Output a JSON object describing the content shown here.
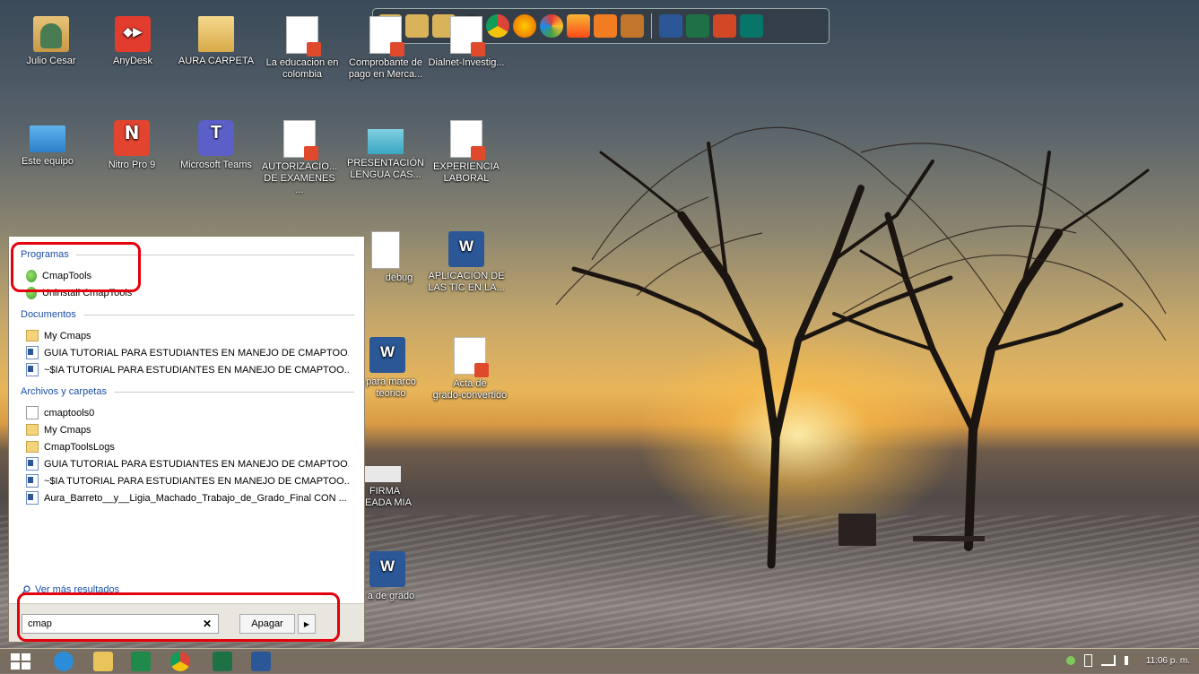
{
  "desktop": {
    "icons": [
      {
        "label": "Julio Cesar",
        "icon": "user-folder-icon"
      },
      {
        "label": "AnyDesk",
        "icon": "anydesk-icon"
      },
      {
        "label": "AURA CARPETA",
        "icon": "folder-icon"
      },
      {
        "label": "La educacion en\ncolombia",
        "icon": "pdf-document-icon"
      },
      {
        "label": "Comprobante de\npago en Merca...",
        "icon": "pdf-document-icon"
      },
      {
        "label": "Dialnet-Investig...",
        "icon": "pdf-document-icon"
      },
      {
        "label": "Este equipo",
        "icon": "computer-icon"
      },
      {
        "label": "Nitro Pro 9",
        "icon": "nitro-pro-icon"
      },
      {
        "label": "Microsoft Teams",
        "icon": "teams-icon"
      },
      {
        "label": "AUTORIZACIO...\nDE EXAMENES ...",
        "icon": "pdf-document-icon"
      },
      {
        "label": "PRESENTACIÓN\nLENGUA CAS...",
        "icon": "powerpoint-file-icon"
      },
      {
        "label": "EXPERIENCIA\nLABORAL",
        "icon": "pdf-document-icon"
      },
      {
        "label": "debug",
        "icon": "text-file-icon"
      },
      {
        "label": "APLICACIÓN DE\nLAS TIC EN LA...",
        "icon": "word-file-icon"
      },
      {
        "label": "para marco\nteorico",
        "icon": "word-file-icon"
      },
      {
        "label": "Acta de\ngrado-convertido",
        "icon": "pdf-document-icon"
      },
      {
        "label": "FIRMA\nNEADA MIA",
        "icon": "image-file-icon"
      },
      {
        "label": "a de grado",
        "icon": "word-file-icon"
      }
    ]
  },
  "search_panel": {
    "sections": {
      "programs": "Programas",
      "documents": "Documentos",
      "files_folders": "Archivos y carpetas"
    },
    "programs": [
      {
        "label": "CmapTools",
        "icon": "cmaptools-icon"
      },
      {
        "label": "Uninstall CmapTools",
        "icon": "cmaptools-icon"
      }
    ],
    "documents": [
      {
        "label": "My Cmaps",
        "icon": "folder-icon"
      },
      {
        "label": "GUIA TUTORIAL PARA ESTUDIANTES EN MANEJO DE CMAPTOO...",
        "icon": "word-doc-icon"
      },
      {
        "label": "~$IA TUTORIAL PARA ESTUDIANTES EN MANEJO DE CMAPTOO...",
        "icon": "word-doc-icon"
      }
    ],
    "files": [
      {
        "label": "cmaptools0",
        "icon": "text-file-icon"
      },
      {
        "label": "My Cmaps",
        "icon": "folder-icon"
      },
      {
        "label": "CmapToolsLogs",
        "icon": "folder-icon"
      },
      {
        "label": "GUIA TUTORIAL PARA ESTUDIANTES EN MANEJO DE CMAPTOO...",
        "icon": "word-doc-icon"
      },
      {
        "label": "~$IA TUTORIAL PARA ESTUDIANTES EN MANEJO DE CMAPTOO...",
        "icon": "word-doc-icon"
      },
      {
        "label": "Aura_Barreto__y__Ligia_Machado_Trabajo_de_Grado_Final CON ...",
        "icon": "word-doc-icon"
      }
    ],
    "more_results": "Ver más resultados",
    "search_value": "cmap",
    "clear_glyph": "✕",
    "shutdown_label": "Apagar",
    "shutdown_arrow": "▶"
  },
  "taskbar": {
    "pinned": [
      "internet-explorer-icon",
      "file-explorer-icon",
      "outlook-icon",
      "chrome-icon",
      "excel-icon",
      "word-icon"
    ],
    "clock": "11:06 p. m."
  },
  "colors": {
    "highlight": "#e4000d",
    "section_title": "#1a4ea8"
  }
}
